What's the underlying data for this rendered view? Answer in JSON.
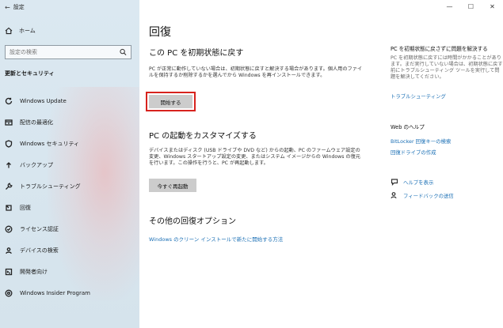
{
  "window": {
    "title": "設定"
  },
  "sidebar": {
    "home_label": "ホーム",
    "search_placeholder": "設定の検索",
    "section_label": "更新とセキュリティ",
    "items": [
      {
        "label": "Windows Update",
        "icon": "refresh-icon"
      },
      {
        "label": "配信の最適化",
        "icon": "delivery-icon"
      },
      {
        "label": "Windows セキュリティ",
        "icon": "shield-icon"
      },
      {
        "label": "バックアップ",
        "icon": "backup-icon"
      },
      {
        "label": "トラブルシューティング",
        "icon": "wrench-icon"
      },
      {
        "label": "回復",
        "icon": "recovery-icon"
      },
      {
        "label": "ライセンス認証",
        "icon": "check-circle-icon"
      },
      {
        "label": "デバイスの検索",
        "icon": "person-pin-icon"
      },
      {
        "label": "開発者向け",
        "icon": "developer-icon"
      },
      {
        "label": "Windows Insider Program",
        "icon": "insider-icon"
      }
    ]
  },
  "main": {
    "title": "回復",
    "reset": {
      "title": "この PC を初期状態に戻す",
      "description": "PC が正常に動作していない場合は、初期状態に戻すと解決する場合があります。個人用のファイルを保持するか削除するかを選んでから Windows を再インストールできます。",
      "button": "開始する"
    },
    "startup": {
      "title": "PC の起動をカスタマイズする",
      "description": "デバイスまたはディスク (USB ドライブや DVD など) からの起動、PC のファームウェア設定の変更、Windows スタートアップ設定の変更、またはシステム イメージからの Windows の復元を行います。この操作を行うと、PC が再起動します。",
      "button": "今すぐ再起動"
    },
    "other": {
      "title": "その他の回復オプション",
      "link": "Windows のクリーン インストールで新たに開始する方法"
    }
  },
  "right_panel": {
    "issue_title": "PC を初期状態に戻さずに問題を解決する",
    "issue_text": "PC を初期状態に戻すには時間がかかることがあります。まだ実行していない場合は、初期状態に戻す前にトラブルシューティング ツールを実行して問題を解決してください。",
    "troubleshoot_link": "トラブルシューティング",
    "web_help_title": "Web のヘルプ",
    "web_links": [
      "BitLocker 回復キーの検索",
      "回復ドライブの作成"
    ],
    "help_link": "ヘルプを表示",
    "feedback_link": "フィードバックの送信"
  }
}
